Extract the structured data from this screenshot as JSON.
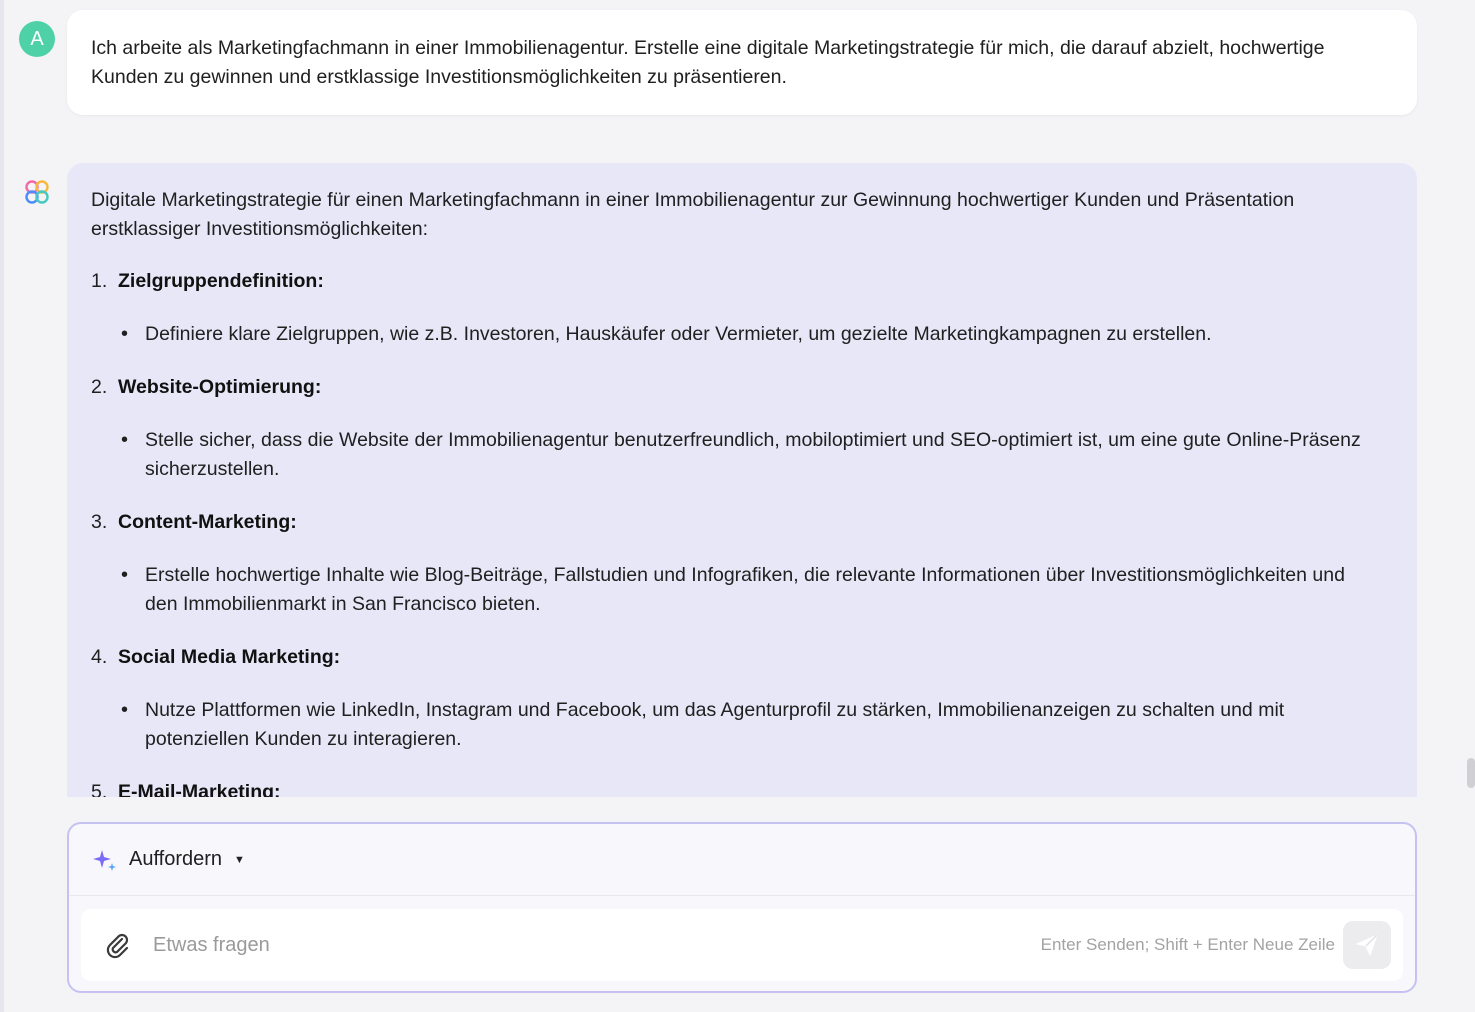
{
  "user": {
    "avatar_letter": "A",
    "message": "Ich arbeite als Marketingfachmann in einer Immobilienagentur. Erstelle eine digitale Marketingstrategie für mich, die darauf abzielt, hochwertige Kunden zu gewinnen und erstklassige Investitionsmöglichkeiten zu präsentieren."
  },
  "assistant": {
    "intro": "Digitale Marketingstrategie für einen Marketingfachmann in einer Immobilienagentur zur Gewinnung hochwertiger Kunden und Präsentation erstklassiger Investitionsmöglichkeiten:",
    "sections": [
      {
        "num": "1.",
        "title": "Zielgruppendefinition:",
        "bullet": "Definiere klare Zielgruppen, wie z.B. Investoren, Hauskäufer oder Vermieter, um gezielte Marketingkampagnen zu erstellen."
      },
      {
        "num": "2.",
        "title": "Website-Optimierung:",
        "bullet": "Stelle sicher, dass die Website der Immobilienagentur benutzerfreundlich, mobiloptimiert und SEO-optimiert ist, um eine gute Online-Präsenz sicherzustellen."
      },
      {
        "num": "3.",
        "title": "Content-Marketing:",
        "bullet": "Erstelle hochwertige Inhalte wie Blog-Beiträge, Fallstudien und Infografiken, die relevante Informationen über Investitionsmöglichkeiten und den Immobilienmarkt in San Francisco bieten."
      },
      {
        "num": "4.",
        "title": "Social Media Marketing:",
        "bullet": "Nutze Plattformen wie LinkedIn, Instagram und Facebook, um das Agenturprofil zu stärken, Immobilienanzeigen zu schalten und mit potenziellen Kunden zu interagieren."
      },
      {
        "num": "5.",
        "title": "E-Mail-Marketing:",
        "bullet": ""
      }
    ]
  },
  "composer": {
    "mode_label": "Auffordern",
    "placeholder": "Etwas fragen",
    "hint": "Enter Senden; Shift + Enter Neue Zeile"
  },
  "icons": {
    "sparkle": "sparkle-icon",
    "paperclip": "paperclip-icon",
    "send": "send-icon",
    "bot": "bot-logo-icon"
  },
  "colors": {
    "avatar": "#4fd1a8",
    "assistant_bubble": "#e7e7f8",
    "composer_border": "#c5c2f2",
    "sparkle": "#7b6cf6"
  }
}
